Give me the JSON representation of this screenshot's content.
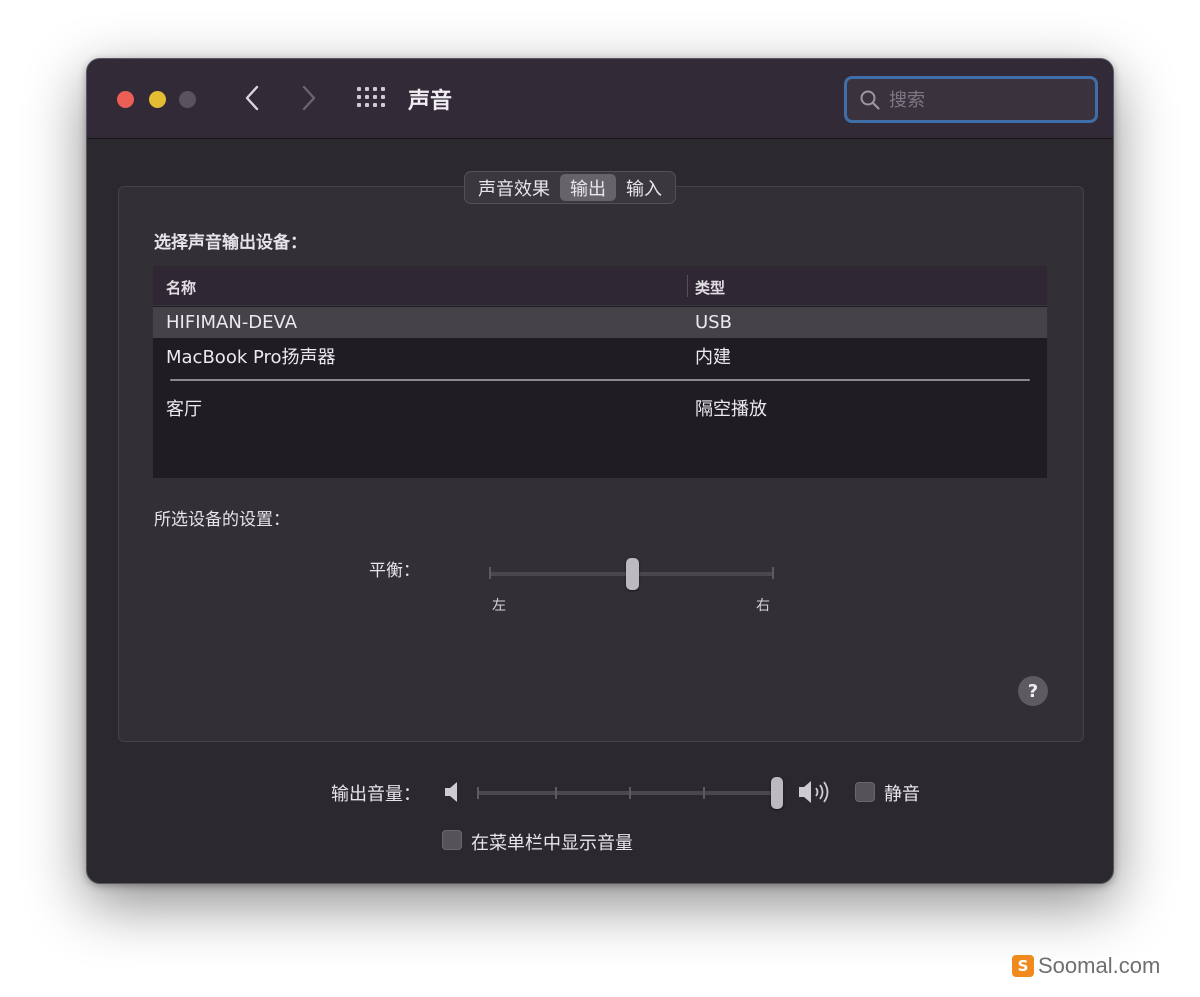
{
  "window": {
    "title": "声音",
    "search_placeholder": "搜索"
  },
  "tabs": [
    {
      "label": "声音效果",
      "active": false
    },
    {
      "label": "输出",
      "active": true
    },
    {
      "label": "输入",
      "active": false
    }
  ],
  "output": {
    "select_label": "选择声音输出设备：",
    "columns": {
      "name": "名称",
      "type": "类型"
    },
    "devices": [
      {
        "name": "HIFIMAN-DEVA",
        "type": "USB",
        "selected": true
      },
      {
        "name": "MacBook Pro扬声器",
        "type": "内建",
        "selected": false
      },
      {
        "name": "客厅",
        "type": "隔空播放",
        "selected": false
      }
    ]
  },
  "settings": {
    "label": "所选设备的设置：",
    "balance_label": "平衡：",
    "balance_left": "左",
    "balance_right": "右",
    "balance_value": 0.5
  },
  "help": "?",
  "volume": {
    "label": "输出音量：",
    "value": 1.0,
    "mute_label": "静音",
    "mute_checked": false,
    "show_in_menubar_label": "在菜单栏中显示音量",
    "show_in_menubar_checked": false
  },
  "watermark": {
    "logo": "S",
    "text": "Soomal.com"
  },
  "colors": {
    "window_bg": "#2b292e",
    "titlebar_bg": "#332a38",
    "close": "#ec5f57",
    "minimize": "#e5bd33",
    "search_focus": "#3f6fa8",
    "watermark_orange": "#f08a1c"
  }
}
